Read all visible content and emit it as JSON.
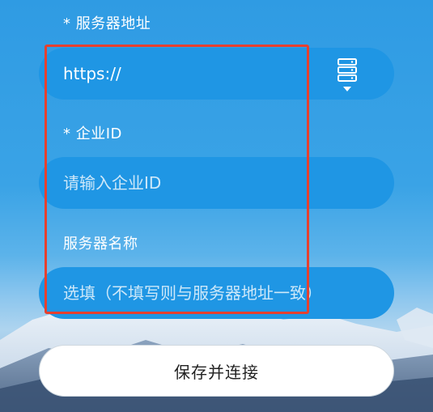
{
  "form": {
    "server_address": {
      "label": "* 服务器地址",
      "value": "https://",
      "dropdown_icon": "server-stack-icon"
    },
    "enterprise_id": {
      "label": "* 企业ID",
      "placeholder": "请输入企业ID"
    },
    "server_name": {
      "label": "服务器名称",
      "placeholder": "选填（不填写则与服务器地址一致）"
    },
    "submit_label": "保存并连接"
  },
  "colors": {
    "input_background": "#1f96e4",
    "highlight_border": "#e6402e",
    "button_background": "#ffffff"
  }
}
